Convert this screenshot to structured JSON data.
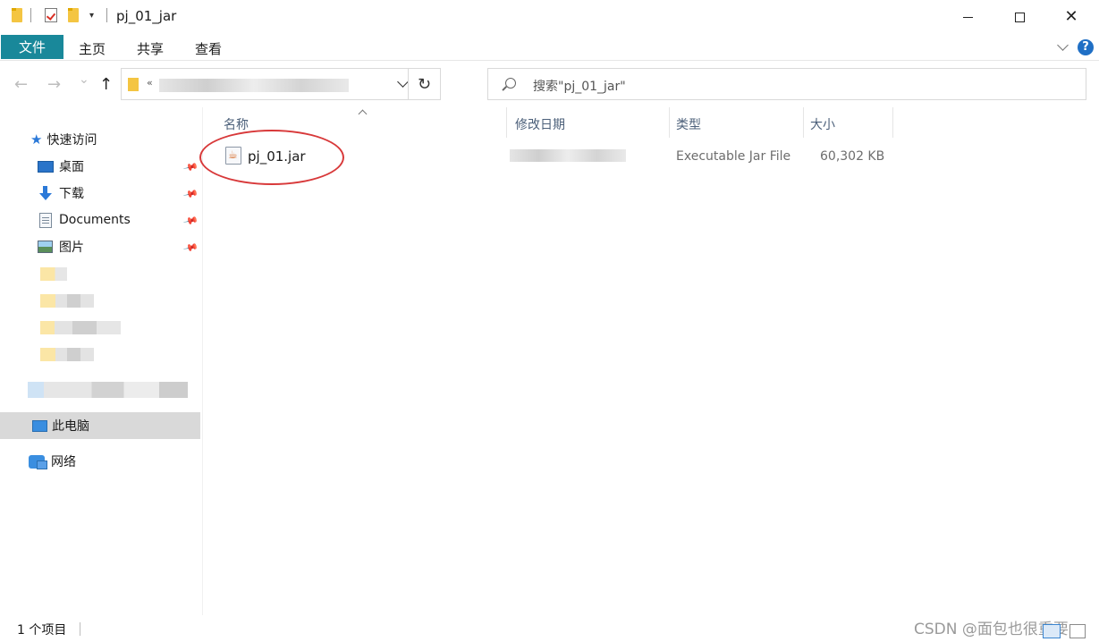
{
  "window": {
    "title": "pj_01_jar",
    "controls": {
      "minimize": "minimize-icon",
      "maximize": "maximize-icon",
      "close": "✕"
    }
  },
  "ribbon": {
    "tabs": [
      "文件",
      "主页",
      "共享",
      "查看"
    ],
    "help": "?"
  },
  "nav": {
    "back": "←",
    "forward": "→",
    "recent": "⌄",
    "up": "↑",
    "address_prefix": "«",
    "refresh": "↻",
    "search_placeholder": "搜索\"pj_01_jar\""
  },
  "sidebar": {
    "quick_access": "快速访问",
    "pinned": [
      "桌面",
      "下载",
      "Documents",
      "图片"
    ],
    "this_pc": "此电脑",
    "network": "网络"
  },
  "file_list": {
    "columns": [
      "名称",
      "修改日期",
      "类型",
      "大小"
    ],
    "rows": [
      {
        "name": "pj_01.jar",
        "modified": "",
        "type": "Executable Jar File",
        "size": "60,302 KB"
      }
    ]
  },
  "status": {
    "count": "1 个项目",
    "watermark": "CSDN @面包也很重要"
  },
  "colors": {
    "file_tab": "#19889a",
    "accent": "#2b79d8",
    "highlight": "#d8393a"
  }
}
